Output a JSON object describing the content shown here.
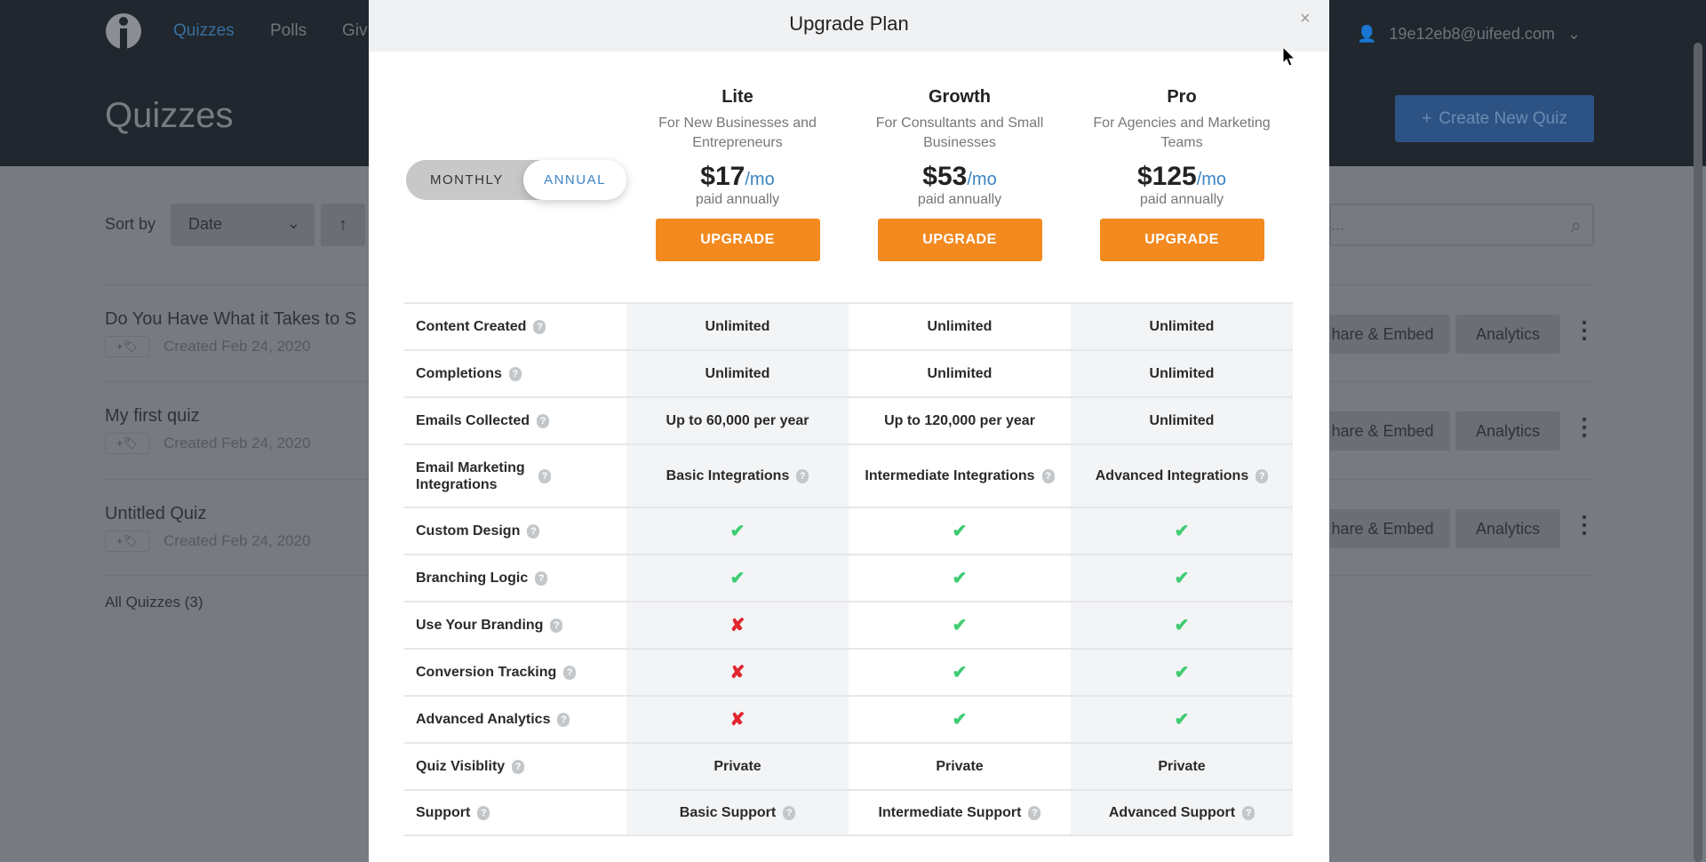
{
  "nav": {
    "items": [
      "Quizzes",
      "Polls",
      "Giv"
    ],
    "user_email": "19e12eb8@uifeed.com"
  },
  "page": {
    "title": "Quizzes",
    "create_button": "Create New Quiz",
    "sort_label": "Sort by",
    "sort_value": "Date",
    "search_placeholder": "..."
  },
  "quizzes": [
    {
      "title": "Do You Have What it Takes to S",
      "created": "Created Feb 24, 2020",
      "tag": "+"
    },
    {
      "title": "My first quiz",
      "created": "Created Feb 24, 2020",
      "tag": "+"
    },
    {
      "title": "Untitled Quiz",
      "created": "Created Feb 24, 2020",
      "tag": "+"
    }
  ],
  "quiz_actions": {
    "share": "hare & Embed",
    "analytics": "Analytics"
  },
  "all_quizzes": "All Quizzes (3)",
  "modal": {
    "title": "Upgrade Plan",
    "close": "×",
    "toggle": {
      "monthly": "MONTHLY",
      "annual": "ANNUAL",
      "selected": "annual"
    },
    "plans": [
      {
        "name": "Lite",
        "desc": "For New Businesses and Entrepreneurs",
        "price": "$17",
        "per": "/mo",
        "billing": "paid annually",
        "button": "UPGRADE"
      },
      {
        "name": "Growth",
        "desc": "For Consultants and Small Businesses",
        "price": "$53",
        "per": "/mo",
        "billing": "paid annually",
        "button": "UPGRADE"
      },
      {
        "name": "Pro",
        "desc": "For Agencies and Marketing Teams",
        "price": "$125",
        "per": "/mo",
        "billing": "paid annually",
        "button": "UPGRADE"
      }
    ],
    "features": [
      {
        "label": "Content Created",
        "values": [
          "Unlimited",
          "Unlimited",
          "Unlimited"
        ]
      },
      {
        "label": "Completions",
        "values": [
          "Unlimited",
          "Unlimited",
          "Unlimited"
        ]
      },
      {
        "label": "Emails Collected",
        "values": [
          "Up to 60,000 per year",
          "Up to 120,000 per year",
          "Unlimited"
        ]
      },
      {
        "label": "Email Marketing Integrations",
        "values": [
          "Basic Integrations",
          "Intermediate Integrations",
          "Advanced Integrations"
        ],
        "help_values": true
      },
      {
        "label": "Custom Design",
        "values": [
          "✔",
          "✔",
          "✔"
        ]
      },
      {
        "label": "Branching Logic",
        "values": [
          "✔",
          "✔",
          "✔"
        ]
      },
      {
        "label": "Use Your Branding",
        "values": [
          "✘",
          "✔",
          "✔"
        ]
      },
      {
        "label": "Conversion Tracking",
        "values": [
          "✘",
          "✔",
          "✔"
        ]
      },
      {
        "label": "Advanced Analytics",
        "values": [
          "✘",
          "✔",
          "✔"
        ]
      },
      {
        "label": "Quiz Visiblity",
        "values": [
          "Private",
          "Private",
          "Private"
        ]
      },
      {
        "label": "Support",
        "values": [
          "Basic Support",
          "Intermediate Support",
          "Advanced Support"
        ],
        "help_values": true
      }
    ]
  },
  "colors": {
    "accent": "#3a84c4",
    "upgrade": "#f28a1f",
    "check": "#3fcc72",
    "cross": "#e0262f"
  }
}
